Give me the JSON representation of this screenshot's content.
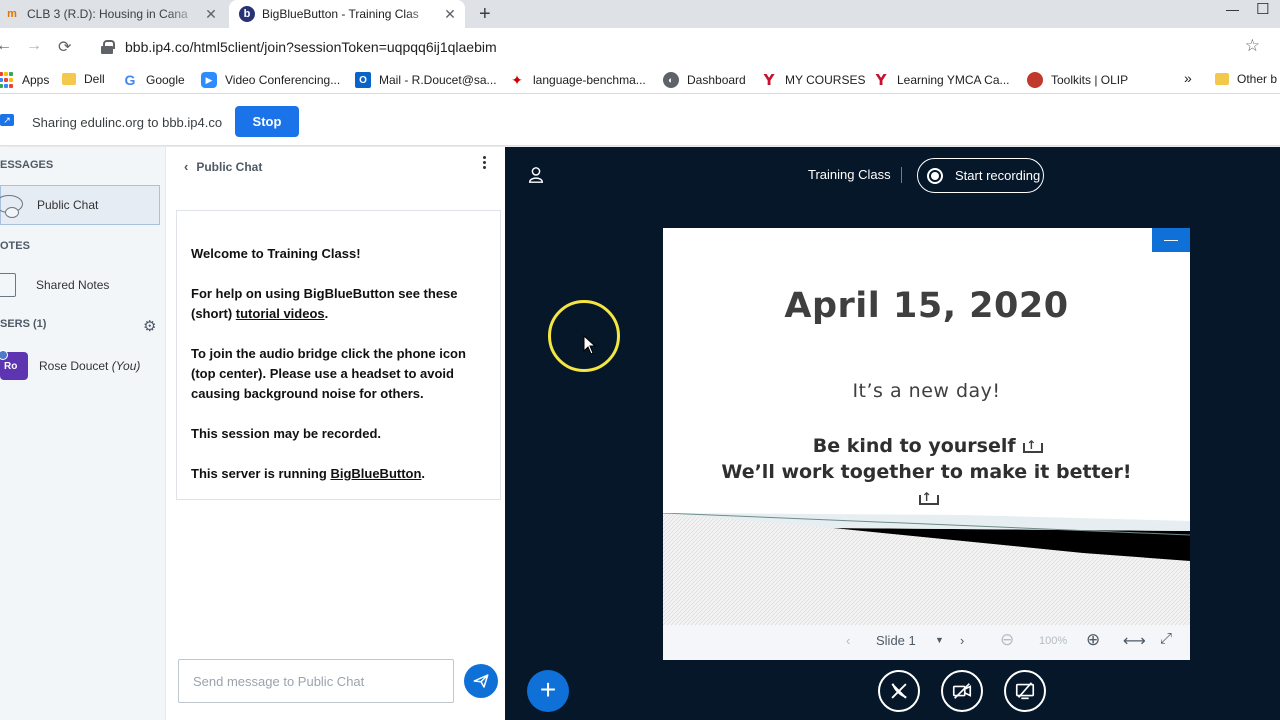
{
  "browser": {
    "tabs": [
      {
        "title": "CLB 3 (R.D): Housing in Cana",
        "icon": "m-icon"
      },
      {
        "title": "BigBlueButton - Training Clas",
        "icon": "bbb-icon"
      }
    ],
    "url": "bbb.ip4.co/html5client/join?sessionToken=uqpqq6ij1qlaebim",
    "bookmarks": [
      "Apps",
      "Dell",
      "Google",
      "Video Conferencing...",
      "Mail - R.Doucet@sa...",
      "language-benchma...",
      "Dashboard",
      "MY COURSES",
      "Learning YMCA Ca...",
      "Toolkits | OLIP",
      "Other b"
    ],
    "overflow": "»"
  },
  "sharing": {
    "text": "Sharing edulinc.org to bbb.ip4.co",
    "stop_label": "Stop"
  },
  "leftnav": {
    "messages_label": "ESSAGES",
    "public_chat_label": "Public Chat",
    "notes_label": "OTES",
    "shared_notes_label": "Shared Notes",
    "users_label": "SERS (1)",
    "user": {
      "initials": "Ro",
      "name": "Rose Doucet",
      "you": "(You)"
    }
  },
  "chat": {
    "header": "Public Chat",
    "welcome": {
      "line1": "Welcome to Training Class!",
      "help_prefix": "For help on using BigBlueButton see these (short) ",
      "help_link": "tutorial videos",
      "help_suffix": ".",
      "audio": "To join the audio bridge click the phone icon (top center). Please use a headset to avoid causing background noise for others.",
      "recorded": "This session may be recorded.",
      "server_prefix": "This server is running ",
      "server_link": "BigBlueButton",
      "server_suffix": "."
    },
    "input_placeholder": "Send message to Public Chat"
  },
  "stage": {
    "meeting_title": "Training Class",
    "record_label": "Start recording",
    "slide": {
      "date": "April 15, 2020",
      "line1": "It’s a new day!",
      "line2a": "Be kind to yourself",
      "line2b": "We’ll work together to make it better!"
    },
    "controls": {
      "slide_label": "Slide 1",
      "dropdown": "▼",
      "zoom": "100%"
    }
  },
  "colors": {
    "accent": "#0f70d7",
    "stage_bg": "#06172a",
    "cursor_highlight": "#f4e542"
  }
}
